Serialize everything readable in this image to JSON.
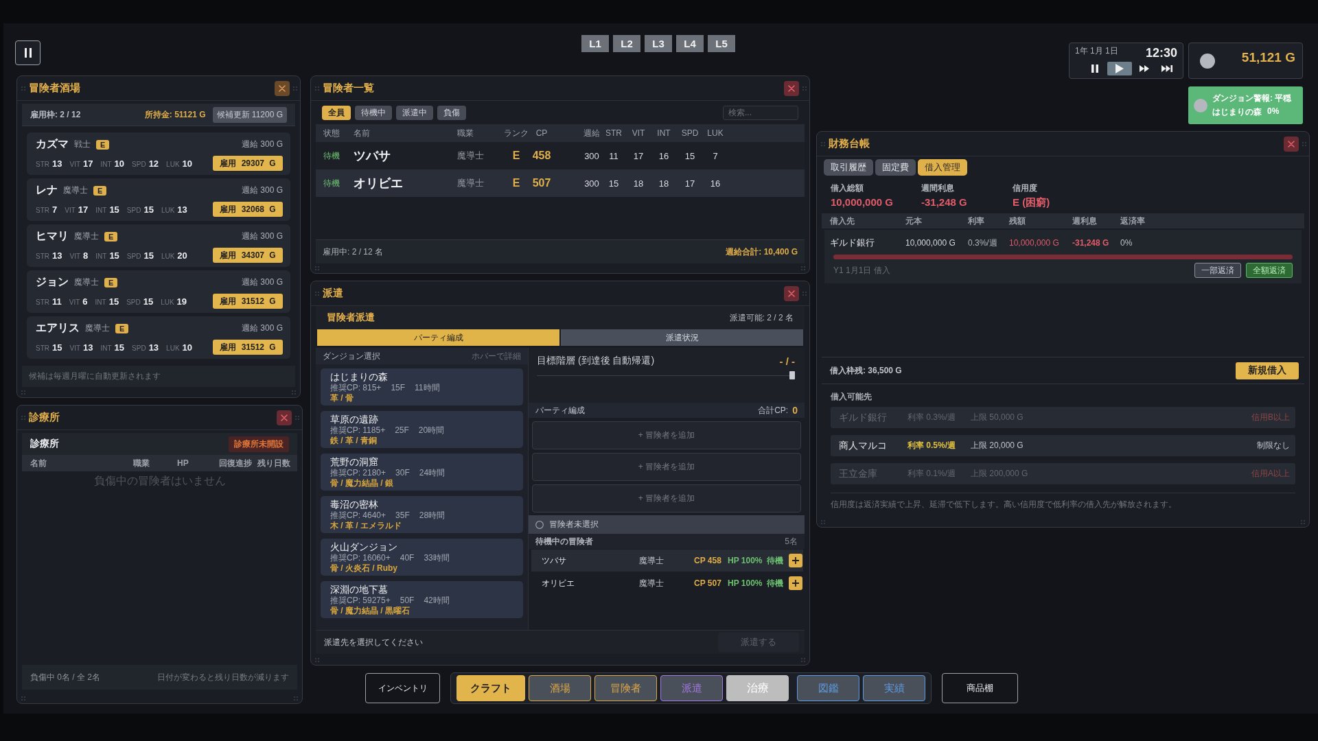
{
  "layer_buttons": [
    "L1",
    "L2",
    "L3",
    "L4",
    "L5"
  ],
  "clock": {
    "date": "1年 1月 1日",
    "time": "12:30",
    "speed_controls": [
      {
        "kind": "pause",
        "selected": false
      },
      {
        "kind": "play",
        "selected": true
      },
      {
        "kind": "fast",
        "selected": false
      },
      {
        "kind": "skip",
        "selected": false
      }
    ]
  },
  "gold": {
    "amount": "51,121 G"
  },
  "dungeon_alert": {
    "title": "ダンジョン警報: 平穏",
    "dungeon": "はじまりの森",
    "risk": "0%"
  },
  "tavern": {
    "title": "冒険者酒場",
    "slots": "雇用枠: 2 / 12",
    "funds": "所持金: 51121 G",
    "refresh_button": "候補更新 11200 G",
    "candidates": [
      {
        "name": "カズマ",
        "job": "戦士",
        "rank": "E",
        "salary": "週給 300 G",
        "stats": [
          {
            "label": "STR",
            "value": "13"
          },
          {
            "label": "VIT",
            "value": "17"
          },
          {
            "label": "INT",
            "value": "10"
          },
          {
            "label": "SPD",
            "value": "12"
          },
          {
            "label": "LUK",
            "value": "10"
          }
        ],
        "hire_button": "雇用 29307 G"
      },
      {
        "name": "レナ",
        "job": "魔導士",
        "rank": "E",
        "salary": "週給 300 G",
        "stats": [
          {
            "label": "STR",
            "value": "7"
          },
          {
            "label": "VIT",
            "value": "17"
          },
          {
            "label": "INT",
            "value": "15"
          },
          {
            "label": "SPD",
            "value": "15"
          },
          {
            "label": "LUK",
            "value": "13"
          }
        ],
        "hire_button": "雇用 32068 G"
      },
      {
        "name": "ヒマリ",
        "job": "魔導士",
        "rank": "E",
        "salary": "週給 300 G",
        "stats": [
          {
            "label": "STR",
            "value": "13"
          },
          {
            "label": "VIT",
            "value": "8"
          },
          {
            "label": "INT",
            "value": "15"
          },
          {
            "label": "SPD",
            "value": "15"
          },
          {
            "label": "LUK",
            "value": "20"
          }
        ],
        "hire_button": "雇用 34307 G"
      },
      {
        "name": "ジョン",
        "job": "魔導士",
        "rank": "E",
        "salary": "週給 300 G",
        "stats": [
          {
            "label": "STR",
            "value": "11"
          },
          {
            "label": "VIT",
            "value": "6"
          },
          {
            "label": "INT",
            "value": "15"
          },
          {
            "label": "SPD",
            "value": "15"
          },
          {
            "label": "LUK",
            "value": "19"
          }
        ],
        "hire_button": "雇用 31512 G"
      },
      {
        "name": "エアリス",
        "job": "魔導士",
        "rank": "E",
        "salary": "週給 300 G",
        "stats": [
          {
            "label": "STR",
            "value": "15"
          },
          {
            "label": "VIT",
            "value": "13"
          },
          {
            "label": "INT",
            "value": "15"
          },
          {
            "label": "SPD",
            "value": "13"
          },
          {
            "label": "LUK",
            "value": "10"
          }
        ],
        "hire_button": "雇用 31512 G"
      }
    ],
    "footer_note": "候補は毎週月曜に自動更新されます"
  },
  "clinic": {
    "title": "診療所",
    "heading": "診療所",
    "status_badge": "診療所未開設",
    "columns": [
      "名前",
      "職業",
      "HP",
      "回復進捗",
      "残り日数"
    ],
    "empty_message": "負傷中の冒険者はいません",
    "footer_count": "負傷中 0名 / 全 2名",
    "footer_note": "日付が変わると残り日数が減ります"
  },
  "adventurer_list": {
    "title": "冒険者一覧",
    "filters": [
      {
        "label": "全員",
        "selected": true
      },
      {
        "label": "待機中",
        "selected": false
      },
      {
        "label": "派遣中",
        "selected": false
      },
      {
        "label": "負傷",
        "selected": false
      }
    ],
    "search": {
      "placeholder": "検索..."
    },
    "columns": [
      "状態",
      "名前",
      "職業",
      "ランク",
      "CP",
      "週給",
      "STR",
      "VIT",
      "INT",
      "SPD",
      "LUK"
    ],
    "rows": [
      {
        "cells": [
          "待機",
          "ツバサ",
          "魔導士",
          "E",
          "458",
          "300",
          "11",
          "17",
          "16",
          "15",
          "7"
        ]
      },
      {
        "cells": [
          "待機",
          "オリビエ",
          "魔導士",
          "E",
          "507",
          "300",
          "15",
          "18",
          "18",
          "17",
          "16"
        ]
      }
    ],
    "footer_count": "雇用中: 2 / 12 名",
    "footer_total": "週給合計: 10,400 G"
  },
  "dispatch": {
    "title": "派遣",
    "heading": "冒険者派遣",
    "capacity": "派遣可能: 2 / 2 名",
    "tabs": [
      {
        "label": "パーティ編成",
        "selected": true
      },
      {
        "label": "派遣状況",
        "selected": false
      }
    ],
    "dungeon_header": "ダンジョン選択",
    "dungeon_hint": "ホバーで詳細",
    "dungeons": [
      {
        "name": "はじまりの森",
        "recommended_cp": "推奨CP: 815+",
        "floors": "15F",
        "duration": "11時間",
        "materials": "革 / 骨"
      },
      {
        "name": "草原の遺跡",
        "recommended_cp": "推奨CP: 1185+",
        "floors": "25F",
        "duration": "20時間",
        "materials": "鉄 / 革 / 青銅"
      },
      {
        "name": "荒野の洞窟",
        "recommended_cp": "推奨CP: 2180+",
        "floors": "30F",
        "duration": "24時間",
        "materials": "骨 / 魔力結晶 / 銀"
      },
      {
        "name": "毒沼の密林",
        "recommended_cp": "推奨CP: 4640+",
        "floors": "35F",
        "duration": "28時間",
        "materials": "木 / 革 / エメラルド"
      },
      {
        "name": "火山ダンジョン",
        "recommended_cp": "推奨CP: 16060+",
        "floors": "40F",
        "duration": "33時間",
        "materials": "骨 / 火炎石 / Ruby"
      },
      {
        "name": "深淵の地下墓",
        "recommended_cp": "推奨CP: 59275+",
        "floors": "50F",
        "duration": "42時間",
        "materials": "骨 / 魔力結晶 / 黒曜石"
      }
    ],
    "target_floor": {
      "label": "目標階層 (到達後 自動帰還)",
      "value": "- / -",
      "level": 1
    },
    "party": {
      "label": "パーティ編成",
      "total_label": "合計CP:",
      "total": "0",
      "slots": [
        "+ 冒険者を追加",
        "+ 冒険者を追加",
        "+ 冒険者を追加"
      ]
    },
    "selection": {
      "label": "冒険者未選択"
    },
    "waiting": {
      "label": "待機中の冒険者",
      "count": "5名",
      "rows": [
        {
          "name": "ツバサ",
          "job": "魔導士",
          "cp": "CP 458",
          "hp": "HP 100%",
          "status": "待機"
        },
        {
          "name": "オリビエ",
          "job": "魔導士",
          "cp": "CP 507",
          "hp": "HP 100%",
          "status": "待機"
        }
      ]
    },
    "footer_hint": "派遣先を選択してください",
    "dispatch_button": {
      "label": "派遣する",
      "disabled": true
    }
  },
  "finance": {
    "title": "財務台帳",
    "tabs": [
      {
        "label": "取引履歴",
        "selected": false
      },
      {
        "label": "固定費",
        "selected": false
      },
      {
        "label": "借入管理",
        "selected": true
      }
    ],
    "summary": [
      {
        "label": "借入総額",
        "value": "10,000,000 G"
      },
      {
        "label": "週間利息",
        "value": "-31,248 G"
      },
      {
        "label": "信用度",
        "value": "E (困窮)"
      }
    ],
    "loan_columns": [
      "借入先",
      "元本",
      "利率",
      "残額",
      "週利息",
      "返済率"
    ],
    "loans": [
      {
        "cells": [
          "ギルド銀行",
          "10,000,000 G",
          "0.3%/週",
          "10,000,000 G",
          "-31,248 G",
          "0%"
        ],
        "level": 1,
        "date": "Y1 1月1日 借入",
        "partial_button": "一部返済",
        "full_button": "全額返済"
      }
    ],
    "credit_remaining": "借入枠残: 36,500 G",
    "new_loan_button": "新規借入",
    "lenders_label": "借入可能先",
    "lenders": [
      {
        "name": "ギルド銀行",
        "rate": "利率 0.3%/週",
        "limit": "上限 50,000 G",
        "requirement": "信用B以上",
        "disabled": true
      },
      {
        "name": "商人マルコ",
        "rate": "利率 0.5%/週",
        "limit": "上限 20,000 G",
        "requirement": "制限なし",
        "disabled": false
      },
      {
        "name": "王立金庫",
        "rate": "利率 0.1%/週",
        "limit": "上限 200,000 G",
        "requirement": "信用A以上",
        "disabled": true
      }
    ],
    "note": "信用度は返済実績で上昇、延滞で低下します。高い信用度で低利率の借入先が解放されます。"
  },
  "bottom_bar": {
    "left_button": "インベントリ",
    "tab_groups": [
      [
        {
          "label": "クラフト",
          "kind": "accent",
          "color": "#e2b44c"
        },
        {
          "label": "酒場",
          "kind": "plain",
          "color": "#d8a64a"
        },
        {
          "label": "冒険者",
          "kind": "plain",
          "color": "#d8a64a"
        },
        {
          "label": "派遣",
          "kind": "plain",
          "color": "#a578e2"
        },
        {
          "label": "治療",
          "kind": "muted",
          "color": "#bdbdbd"
        }
      ],
      [
        {
          "label": "図鑑",
          "kind": "plain",
          "color": "#5f9be3"
        },
        {
          "label": "実績",
          "kind": "plain",
          "color": "#5f9be3"
        }
      ]
    ],
    "right_button": "商品棚"
  }
}
